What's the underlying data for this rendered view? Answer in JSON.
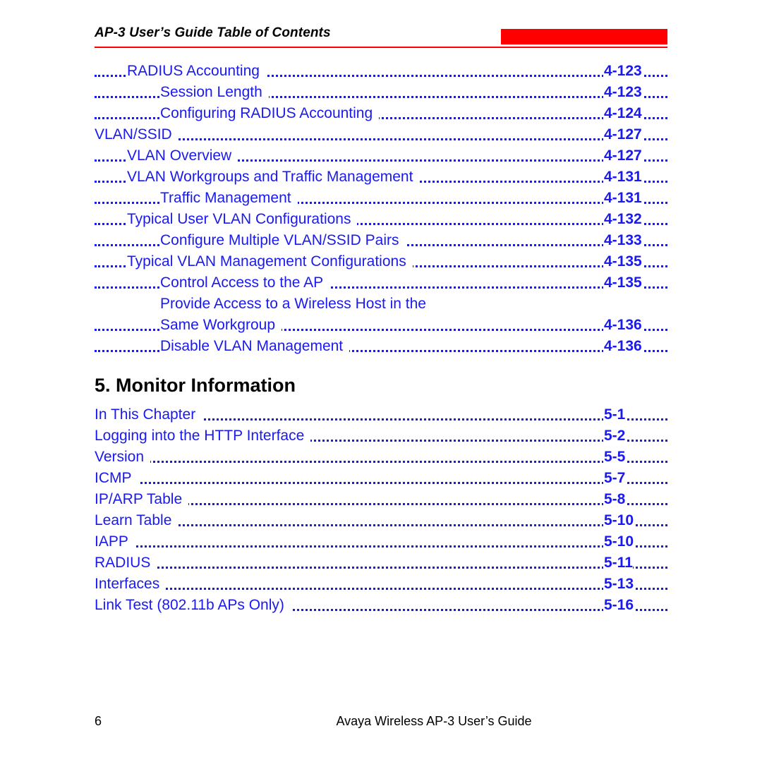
{
  "document": {
    "header_title": "AP-3 User’s Guide Table of Contents",
    "accent_color": "#ff0000",
    "link_color": "#1a1aee",
    "text_color": "#000000"
  },
  "toc_block_1": {
    "entries": [
      {
        "label": "RADIUS Accounting",
        "page": "4-123",
        "level": 1,
        "dots": true
      },
      {
        "label": "Session Length",
        "page": "4-123",
        "level": 2,
        "dots": true
      },
      {
        "label": "Configuring RADIUS Accounting",
        "page": "4-124",
        "level": 2,
        "dots": true
      },
      {
        "label": "VLAN/SSID",
        "page": "4-127",
        "level": 0,
        "dots": true
      },
      {
        "label": "VLAN Overview",
        "page": "4-127",
        "level": 1,
        "dots": true
      },
      {
        "label": "VLAN Workgroups and Traffic Management",
        "page": "4-131",
        "level": 1,
        "dots": true
      },
      {
        "label": "Traffic Management",
        "page": "4-131",
        "level": 2,
        "dots": true
      },
      {
        "label": "Typical User VLAN Configurations",
        "page": "4-132",
        "level": 1,
        "dots": true
      },
      {
        "label": "Configure Multiple VLAN/SSID Pairs",
        "page": "4-133",
        "level": 2,
        "dots": true
      },
      {
        "label": "Typical VLAN Management Configurations",
        "page": "4-135",
        "level": 1,
        "dots": true
      },
      {
        "label": "Control Access to the AP",
        "page": "4-135",
        "level": 2,
        "dots": true
      },
      {
        "label": "Provide Access to a Wireless Host in the",
        "page": "",
        "level": 2,
        "dots": false
      },
      {
        "label": "Same Workgroup",
        "page": "4-136",
        "level": 2,
        "dots": true
      },
      {
        "label": "Disable VLAN Management",
        "page": "4-136",
        "level": 2,
        "dots": true
      }
    ]
  },
  "chapter": {
    "heading": "5. Monitor Information"
  },
  "toc_block_2": {
    "entries": [
      {
        "label": "In This Chapter",
        "page": "5-1",
        "level": 0,
        "dots": true
      },
      {
        "label": "Logging into the HTTP Interface",
        "page": "5-2",
        "level": 0,
        "dots": true
      },
      {
        "label": "Version",
        "page": "5-5",
        "level": 0,
        "dots": true
      },
      {
        "label": "ICMP",
        "page": "5-7",
        "level": 0,
        "dots": true
      },
      {
        "label": "IP/ARP Table",
        "page": "5-8",
        "level": 0,
        "dots": true
      },
      {
        "label": "Learn Table",
        "page": "5-10",
        "level": 0,
        "dots": true
      },
      {
        "label": "IAPP",
        "page": "5-10",
        "level": 0,
        "dots": true
      },
      {
        "label": "RADIUS",
        "page": "5-11",
        "level": 0,
        "dots": true
      },
      {
        "label": "Interfaces",
        "page": "5-13",
        "level": 0,
        "dots": true
      },
      {
        "label": "Link Test (802.11b APs Only)",
        "page": "5-16",
        "level": 0,
        "dots": true
      }
    ]
  },
  "footer": {
    "page_number": "6",
    "guide_text": "Avaya Wireless AP-3 User’s Guide"
  }
}
